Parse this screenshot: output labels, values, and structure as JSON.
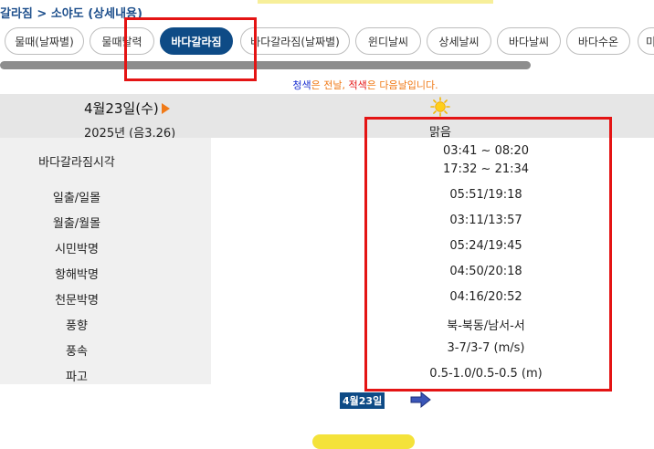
{
  "breadcrumb": "갈라짐 > 소야도 (상세내용)",
  "tabs": [
    {
      "label": "물때(날짜별)",
      "active": false
    },
    {
      "label": "물때달력",
      "active": false
    },
    {
      "label": "바다갈라짐",
      "active": true
    },
    {
      "label": "바다갈라짐(날짜별)",
      "active": false
    },
    {
      "label": "윈디날씨",
      "active": false
    },
    {
      "label": "상세날씨",
      "active": false
    },
    {
      "label": "바다날씨",
      "active": false
    },
    {
      "label": "바다수온",
      "active": false
    },
    {
      "label": "미",
      "active": false
    }
  ],
  "legend": {
    "blue_word": "청색",
    "part1": "은 전날, ",
    "red_word": "적색",
    "part2": "은 다음날입니다."
  },
  "date": {
    "main": "4월23일(수)",
    "sub": "2025년 (음3.26)"
  },
  "weather": {
    "icon": "sun-icon",
    "text": "맑음"
  },
  "rows": [
    {
      "label": "바다갈라짐시각",
      "value": "03:41  ~ 08:20",
      "value2": "17:32  ~ 21:34"
    },
    {
      "label": "일출/일몰",
      "value": "05:51/19:18"
    },
    {
      "label": "월출/월몰",
      "value": "03:11/13:57"
    },
    {
      "label": "시민박명",
      "value": "05:24/19:45"
    },
    {
      "label": "항해박명",
      "value": "04:50/20:18"
    },
    {
      "label": "천문박명",
      "value": "04:16/20:52"
    },
    {
      "label": "풍향",
      "value": "북-북동/남서-서"
    },
    {
      "label": "풍속",
      "value": "3-7/3-7 (m/s)"
    },
    {
      "label": "파고",
      "value": "0.5-1.0/0.5-0.5 (m)"
    }
  ],
  "next_date": "4월23일",
  "colors": {
    "accent": "#0e4b86",
    "highlight": "#e41414",
    "legend_orange": "#f07a18",
    "legend_blue": "#1a2fd0",
    "legend_red": "#e51414"
  }
}
